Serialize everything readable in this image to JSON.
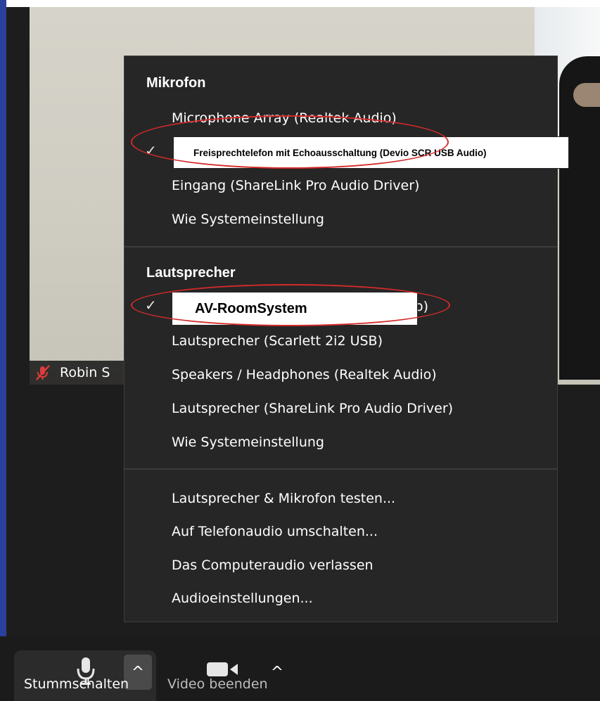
{
  "participant": {
    "name": "Robin S"
  },
  "menu": {
    "mic_header": "Mikrofon",
    "mic_items": [
      {
        "label": "Microphone Array (Realtek Audio)",
        "checked": false
      },
      {
        "label": "",
        "checked": true
      },
      {
        "label": "Eingang (ShareLink Pro Audio Driver)",
        "checked": false
      },
      {
        "label": "Wie Systemeinstellung",
        "checked": false
      }
    ],
    "speaker_header": "Lautsprecher",
    "speaker_items": [
      {
        "label": "o)",
        "checked": true
      },
      {
        "label": "Lautsprecher (Scarlett 2i2 USB)",
        "checked": false
      },
      {
        "label": "Speakers / Headphones (Realtek Audio)",
        "checked": false
      },
      {
        "label": "Lautsprecher (ShareLink Pro Audio Driver)",
        "checked": false
      },
      {
        "label": "Wie Systemeinstellung",
        "checked": false
      }
    ],
    "actions": [
      "Lautsprecher & Mikrofon testen...",
      "Auf Telefonaudio umschalten...",
      "Das Computeraudio verlassen",
      "Audioeinstellungen..."
    ],
    "check_mark": "✓"
  },
  "annotations": {
    "mic_overlay": "Freisprechtelefon mit Echoausschaltung (Devio SCR USB Audio)",
    "speaker_overlay": "AV-RoomSystem",
    "oval_color": "#d42a2a"
  },
  "toolbar": {
    "mute_label": "Stummschalten",
    "video_label": "Video beenden",
    "caret": "^"
  },
  "colors": {
    "menu_bg": "#262626",
    "menu_text": "#ffffff",
    "toolbar_bg": "#1b1b1b",
    "muted_red": "#e03b3b"
  }
}
